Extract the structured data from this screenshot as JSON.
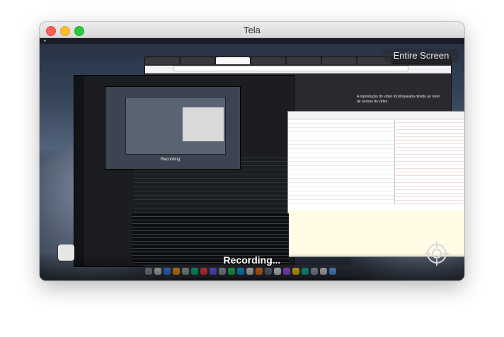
{
  "window": {
    "title": "Tela"
  },
  "overlay": {
    "entire_screen_label": "Entire Screen",
    "recording_label": "Recording...",
    "stop_button_icon": "stop-icon",
    "target_icon": "crosshair-icon"
  },
  "captured": {
    "recursive_recording_label": "Recording",
    "video_note": "A reprodução do vídeo foi bloqueada devido ao nível de acesso do vídeo."
  },
  "colors": {
    "close": "#fe5f57",
    "minimize": "#febc2e",
    "maximize": "#28c840",
    "recording_text": "#ffffff"
  }
}
